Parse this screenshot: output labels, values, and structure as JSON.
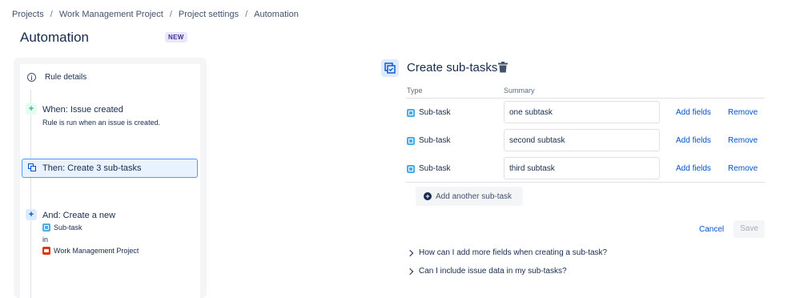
{
  "breadcrumb": [
    "Projects",
    "Work Management Project",
    "Project settings",
    "Automation"
  ],
  "page": {
    "title": "Automation",
    "badge": "NEW"
  },
  "rule": {
    "details_label": "Rule details",
    "when": {
      "title": "When: Issue created",
      "description": "Rule is run when an issue is created."
    },
    "then": {
      "title": "Then: Create 3 sub-tasks"
    },
    "and": {
      "title": "And: Create a new",
      "issue_type": "Sub-task",
      "in_label": "in",
      "project": "Work Management Project"
    }
  },
  "action": {
    "title": "Create sub-tasks",
    "columns": {
      "type": "Type",
      "summary": "Summary"
    },
    "rows": [
      {
        "type": "Sub-task",
        "summary": "one subtask",
        "add_fields": "Add fields",
        "remove": "Remove"
      },
      {
        "type": "Sub-task",
        "summary": "second subtask",
        "add_fields": "Add fields",
        "remove": "Remove"
      },
      {
        "type": "Sub-task",
        "summary": "third subtask",
        "add_fields": "Add fields",
        "remove": "Remove"
      }
    ],
    "add_another_label": "Add another sub-task",
    "cancel_label": "Cancel",
    "save_label": "Save",
    "faqs": [
      "How can I add more fields when creating a sub-task?",
      "Can I include issue data in my sub-tasks?"
    ]
  },
  "colors": {
    "link": "#0052cc",
    "selected_border": "#4c9aff",
    "selected_bg": "#e9f2ff",
    "subtask_icon": "#4bade8",
    "project_icon": "#de350b",
    "trigger_icon": "#36b37e"
  }
}
